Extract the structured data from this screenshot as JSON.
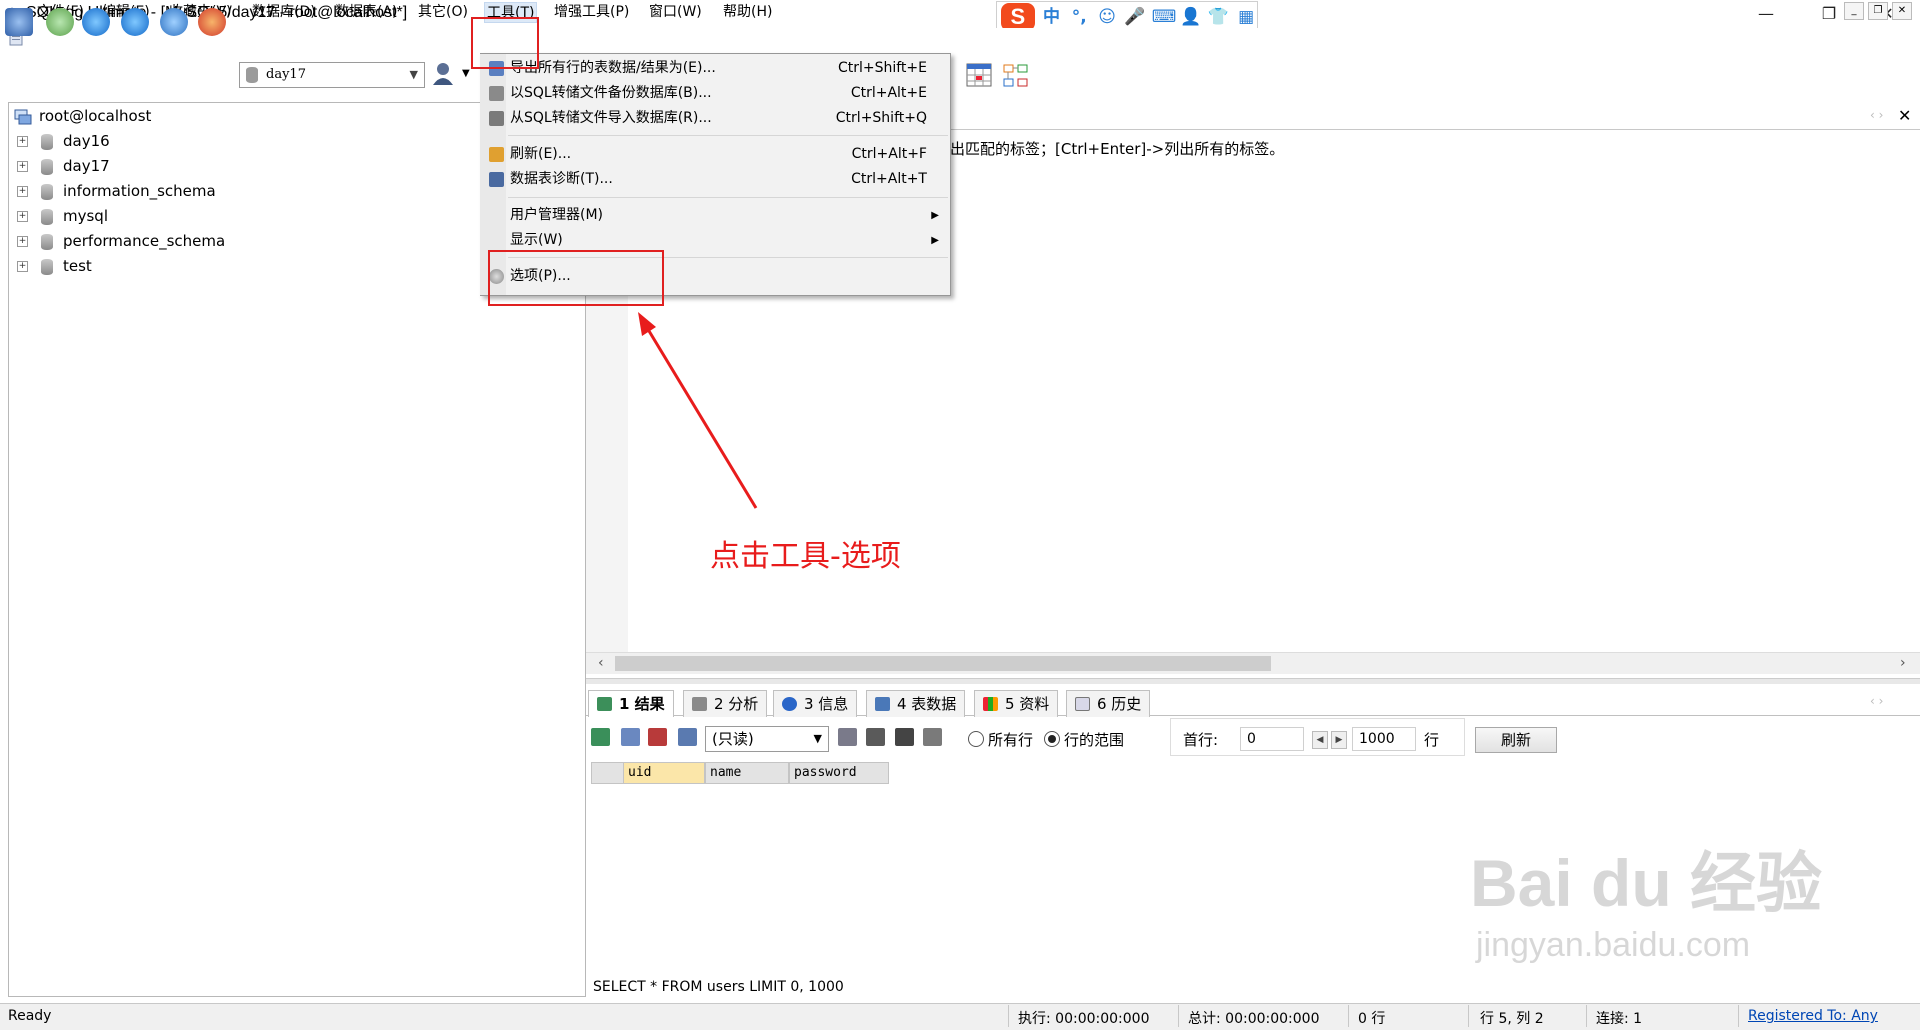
{
  "window": {
    "title": "SQLyog Ultimate - [MySQL5/day17 - root@localhost*]"
  },
  "ime": {
    "logo": "S",
    "mode": "中",
    "punct": "°,",
    "emoji": "☺",
    "mic": "🎤",
    "keyboard": "⌨",
    "user": "👤",
    "shirt": "👕",
    "grid": "▦"
  },
  "menubar": {
    "items": [
      "文件(F)",
      "编辑(E)",
      "收藏夹(V)",
      "数据库(D)",
      "数据表(A)",
      "其它(O)",
      "工具(T)",
      "增强工具(P)",
      "窗口(W)",
      "帮助(H)"
    ],
    "active": "工具(T)"
  },
  "toolbar": {
    "database_selected": "day17"
  },
  "object_browser": {
    "root": "root@localhost",
    "databases": [
      "day16",
      "day17",
      "information_schema",
      "mysql",
      "performance_schema",
      "test"
    ]
  },
  "tools_menu": {
    "items": [
      {
        "label": "导出所有行的表数据/结果为(E)...",
        "shortcut": "Ctrl+Shift+E",
        "icon": "export-icon"
      },
      {
        "label": "以SQL转储文件备份数据库(B)...",
        "shortcut": "Ctrl+Alt+E",
        "icon": "backup-icon"
      },
      {
        "label": "从SQL转储文件导入数据库(R)...",
        "shortcut": "Ctrl+Shift+Q",
        "icon": "import-icon"
      },
      {
        "label": "刷新(E)...",
        "shortcut": "Ctrl+Alt+F",
        "icon": "broom-icon"
      },
      {
        "label": "数据表诊断(T)...",
        "shortcut": "Ctrl+Alt+T",
        "icon": "diagnose-icon"
      },
      {
        "label": "用户管理器(M)",
        "shortcut": "",
        "icon": ""
      },
      {
        "label": "显示(W)",
        "shortcut": "",
        "icon": ""
      },
      {
        "label": "选项(P)...",
        "shortcut": "",
        "icon": "options-icon"
      }
    ]
  },
  "editor": {
    "hint": "出匹配的标签；[Ctrl+Enter]->列出所有的标签。"
  },
  "result_tabs": [
    "1 结果",
    "2 分析",
    "3 信息",
    "4 表数据",
    "5 资料",
    "6 历史"
  ],
  "result_toolbar": {
    "mode": "(只读)",
    "all_rows_label": "所有行",
    "row_range_label": "行的范围",
    "first_row_label": "首行:",
    "first_row_value": "0",
    "row_count_value": "1000",
    "rows_unit": "行",
    "refresh_label": "刷新"
  },
  "grid": {
    "columns": [
      "uid",
      "name",
      "password"
    ]
  },
  "sql_line": "SELECT * FROM users LIMIT 0, 1000",
  "status": {
    "ready": "Ready",
    "exec": "执行: 00:00:00:000",
    "total": "总计: 00:00:00:000",
    "rows": "0 行",
    "position": "行 5, 列 2",
    "connection": "连接: 1",
    "registered": "Registered To: Any"
  },
  "annotation": {
    "text": "点击工具-选项",
    "color": "#e81c1c"
  },
  "watermark": {
    "main": "Bai du 经验",
    "sub": "jingyan.baidu.com"
  },
  "colors": {
    "accent_red": "#e02020",
    "menu_active": "#dde9f7"
  }
}
